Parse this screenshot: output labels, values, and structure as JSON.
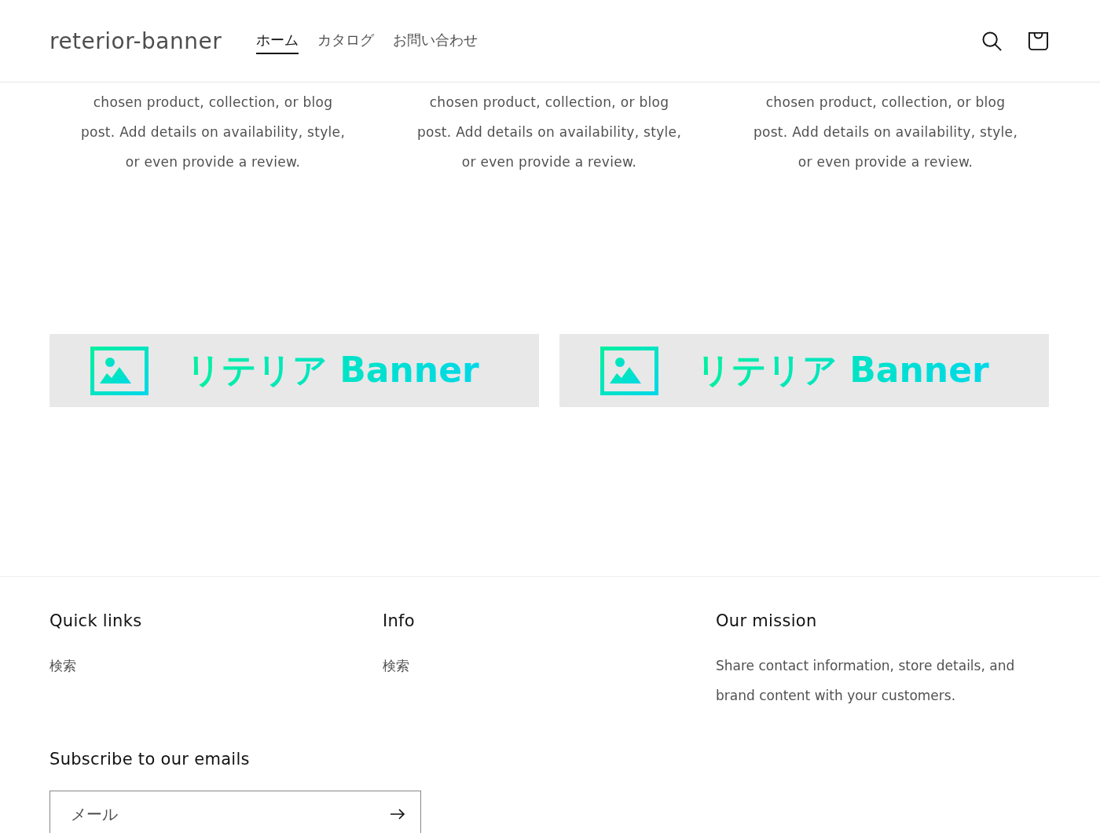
{
  "header": {
    "logo": "reterior-banner",
    "nav": [
      {
        "label": "ホーム",
        "selected": true
      },
      {
        "label": "カタログ",
        "selected": false
      },
      {
        "label": "お問い合わせ",
        "selected": false
      }
    ]
  },
  "columns": [
    {
      "lines": [
        "chosen product, collection, or blog",
        "post. Add details on availability, style,",
        "or even provide a review."
      ]
    },
    {
      "lines": [
        "chosen product, collection, or blog",
        "post. Add details on availability, style,",
        "or even provide a review."
      ]
    },
    {
      "lines": [
        "chosen product, collection, or blog",
        "post. Add details on availability, style,",
        "or even provide a review."
      ]
    }
  ],
  "banners": [
    {
      "text": "リテリア Banner"
    },
    {
      "text": "リテリア Banner"
    }
  ],
  "footer": {
    "blocks": [
      {
        "heading": "Quick links",
        "links": [
          "検索"
        ]
      },
      {
        "heading": "Info",
        "links": [
          "検索"
        ]
      },
      {
        "heading": "Our mission",
        "text": "Share contact information, store details, and brand content with your customers."
      }
    ],
    "subscribe": {
      "heading": "Subscribe to our emails",
      "placeholder": "メール"
    }
  }
}
